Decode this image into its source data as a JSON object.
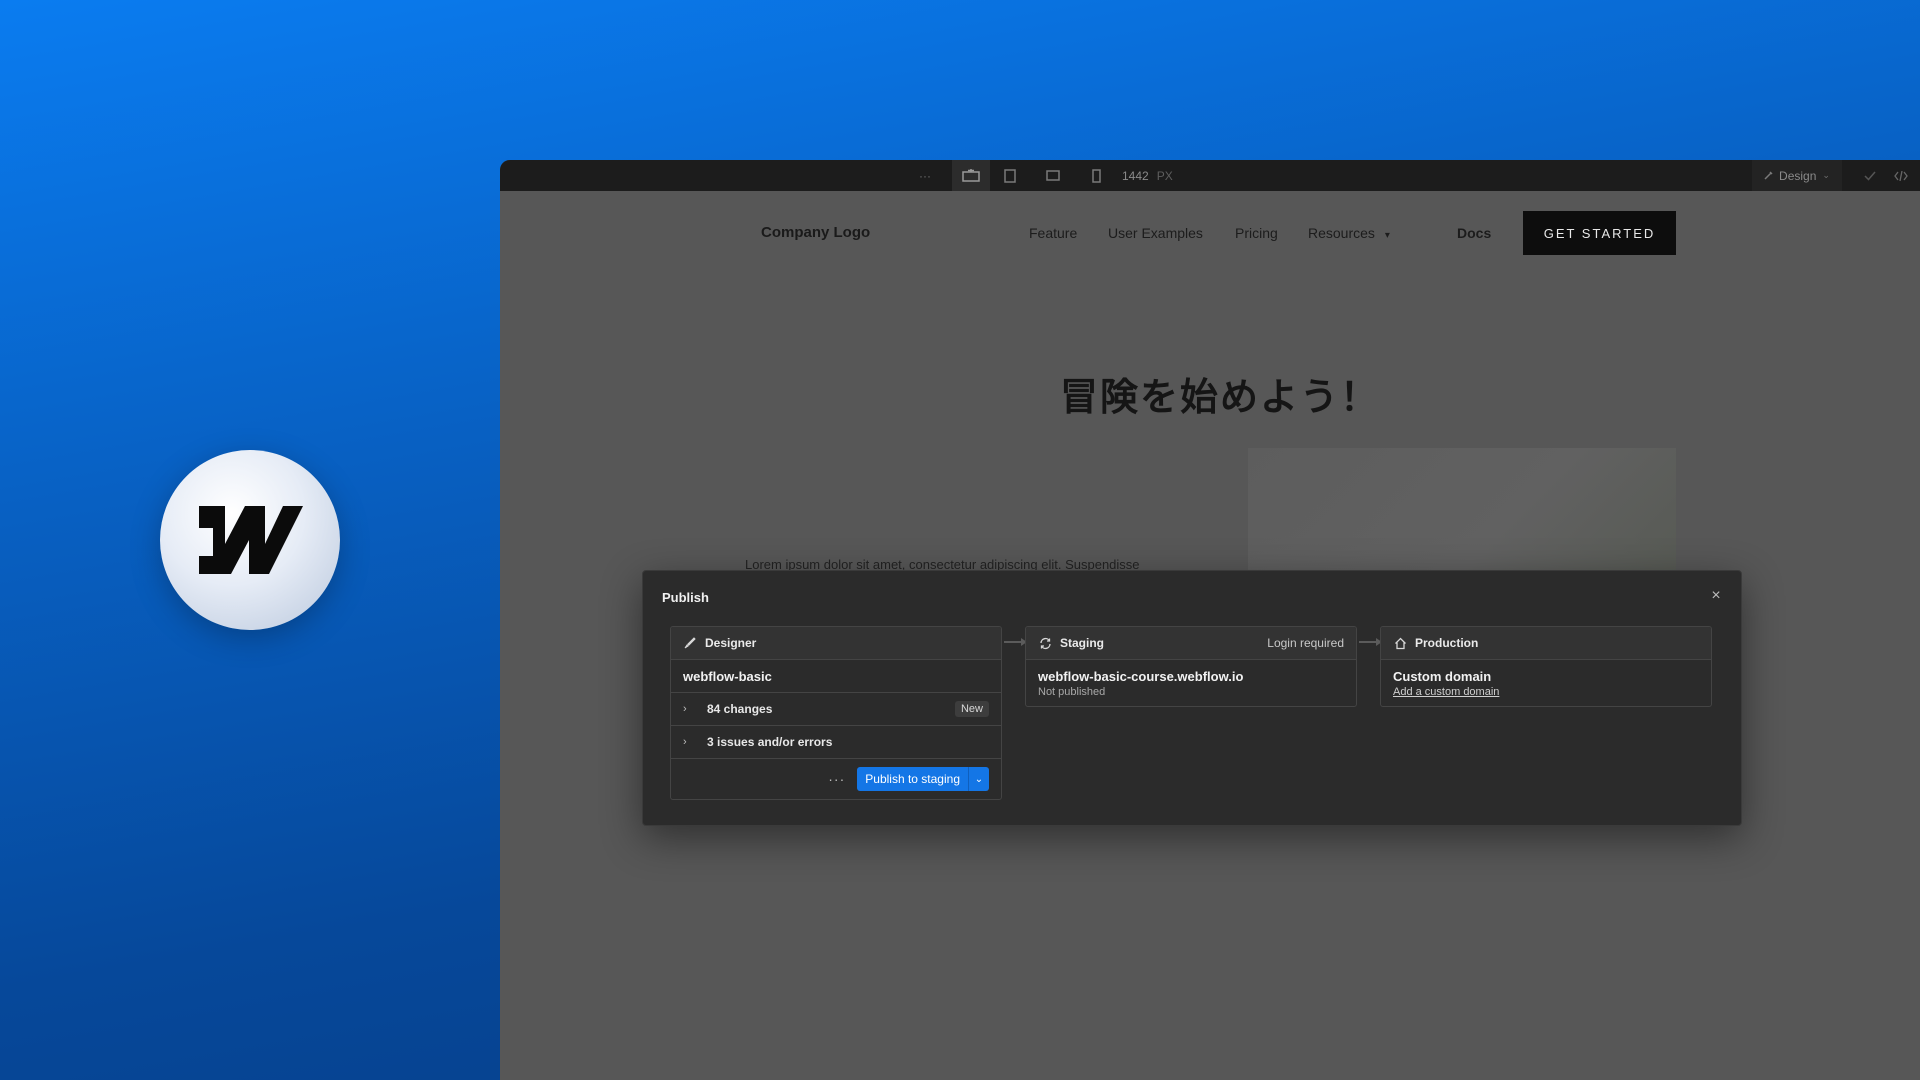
{
  "toolbar": {
    "more": "···",
    "breakpoint_width": "1442",
    "unit": "PX",
    "mode": "Design"
  },
  "site": {
    "logo": "Company Logo",
    "nav": [
      "Feature",
      "User Examples",
      "Pricing",
      "Resources"
    ],
    "docs": "Docs",
    "cta": "GET STARTED",
    "hero_title": "冒険を始めよう！",
    "hero_body": "Lorem ipsum dolor sit amet, consectetur adipiscing elit. Suspendisse"
  },
  "modal": {
    "title": "Publish",
    "designer": {
      "label": "Designer",
      "site_name": "webflow-basic",
      "changes": "84 changes",
      "changes_badge": "New",
      "issues": "3 issues and/or errors",
      "more": "···",
      "publish_button": "Publish to staging"
    },
    "staging": {
      "label": "Staging",
      "status": "Login required",
      "domain": "webflow-basic-course.webflow.io",
      "state": "Not published"
    },
    "production": {
      "label": "Production",
      "domain_title": "Custom domain",
      "add_link": "Add a custom domain"
    }
  },
  "colors": {
    "accent": "#1476e6",
    "background_top": "#0a7cf0",
    "background_bottom": "#053d86"
  }
}
